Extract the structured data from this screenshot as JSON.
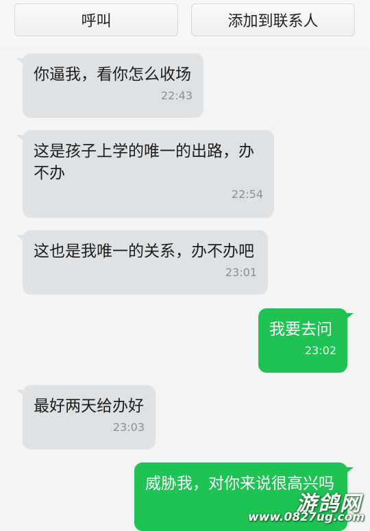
{
  "header": {
    "call_label": "呼叫",
    "add_contact_label": "添加到联系人"
  },
  "messages": [
    {
      "direction": "incoming",
      "text": "你逼我，看你怎么收场",
      "time": "22:43"
    },
    {
      "direction": "incoming",
      "text": "这是孩子上学的唯一的出路，办\n不办",
      "time": "22:54"
    },
    {
      "direction": "incoming",
      "text": "这也是我唯一的关系，办不办吧",
      "time": "23:01"
    },
    {
      "direction": "outgoing",
      "text": "我要去问",
      "time": "23:02"
    },
    {
      "direction": "incoming",
      "text": "最好两天给办好",
      "time": "23:03"
    },
    {
      "direction": "outgoing",
      "text": "威胁我，对你来说很高兴吗",
      "time": ""
    }
  ],
  "watermark": {
    "brand": "游鸽网",
    "url": "www.0827ug.com"
  },
  "colors": {
    "incoming_bubble": "#dfe2e4",
    "outgoing_bubble": "#1ec354",
    "background": "#f4f4f4"
  }
}
